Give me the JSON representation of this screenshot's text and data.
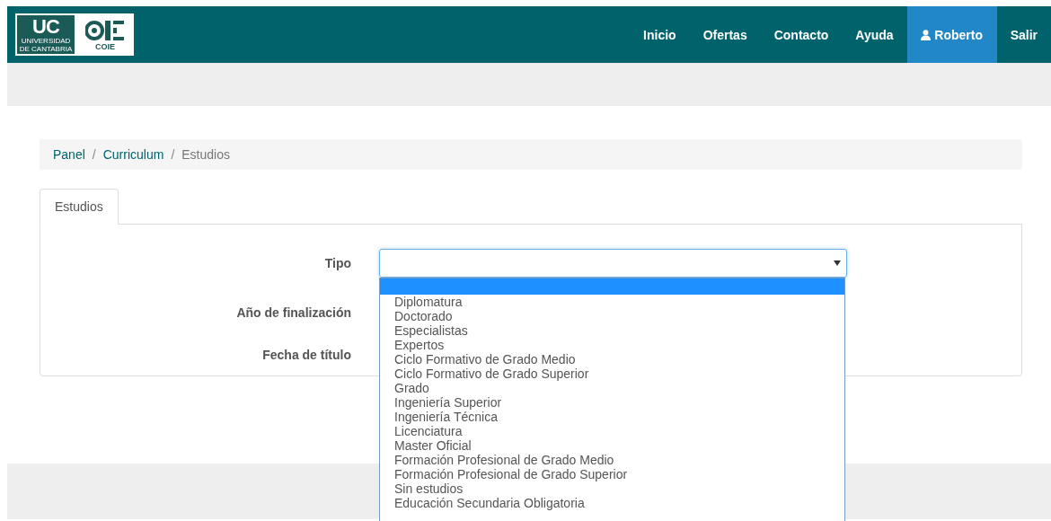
{
  "logo": {
    "initials": "UC",
    "university": "UNIVERSIDAD DE CANTABRIA",
    "unit": "COIE"
  },
  "nav": [
    {
      "label": "Inicio",
      "kind": "link",
      "selected": false
    },
    {
      "label": "Ofertas",
      "kind": "link",
      "selected": false
    },
    {
      "label": "Contacto",
      "kind": "link",
      "selected": false
    },
    {
      "label": "Ayuda",
      "kind": "link",
      "selected": false
    },
    {
      "label": "Roberto",
      "kind": "user",
      "selected": true
    },
    {
      "label": "Salir",
      "kind": "link",
      "selected": false
    }
  ],
  "breadcrumb_separator": "/",
  "breadcrumb": [
    {
      "label": "Panel",
      "kind": "link"
    },
    {
      "label": "Curriculum",
      "kind": "link"
    },
    {
      "label": "Estudios",
      "kind": "current"
    }
  ],
  "tabs": [
    {
      "label": "Estudios",
      "selected": true
    }
  ],
  "form": {
    "fields": [
      {
        "label": "Tipo",
        "kind": "select"
      },
      {
        "label": "Año de finalización",
        "kind": "hidden"
      },
      {
        "label": "Fecha de título",
        "kind": "hidden"
      }
    ]
  },
  "dropdown": {
    "blank_option_selected": true,
    "options": [
      {
        "label": "Diplomatura",
        "selected": false
      },
      {
        "label": "Doctorado",
        "selected": false
      },
      {
        "label": "Especialistas",
        "selected": false
      },
      {
        "label": "Expertos",
        "selected": false
      },
      {
        "label": "Ciclo Formativo de Grado Medio",
        "selected": false
      },
      {
        "label": "Ciclo Formativo de Grado Superior",
        "selected": false
      },
      {
        "label": "Grado",
        "selected": false
      },
      {
        "label": "Ingeniería Superior",
        "selected": false
      },
      {
        "label": "Ingeniería Técnica",
        "selected": false
      },
      {
        "label": "Licenciatura",
        "selected": false
      },
      {
        "label": "Master Oficial",
        "selected": false
      },
      {
        "label": "Formación Profesional de Grado Medio",
        "selected": false
      },
      {
        "label": "Formación Profesional de Grado Superior",
        "selected": false
      },
      {
        "label": "Sin estudios",
        "selected": false
      },
      {
        "label": "Educación Secundaria Obligatoria",
        "selected": false
      }
    ]
  }
}
